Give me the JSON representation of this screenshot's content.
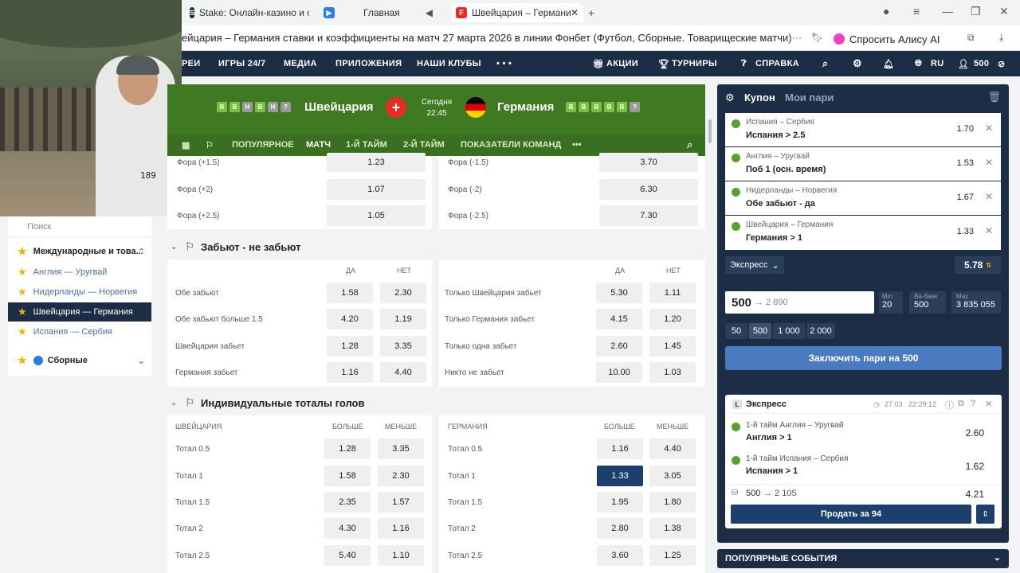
{
  "browser": {
    "tabs": [
      {
        "label": "Stake: Онлайн-казино и с"
      },
      {
        "label": "Главная"
      },
      {
        "label": "Швейцария – Германи"
      }
    ],
    "url": "ейцария – Германия ставки и коэффициенты на матч 27 марта 2026 в линии Фонбет (Футбол, Сборные. Товарищеские матчи)",
    "alice": "Спросить Алису AI"
  },
  "nav": {
    "items": [
      "РЕИ",
      "ИГРЫ 24/7",
      "МЕДИА",
      "ПРИЛОЖЕНИЯ",
      "НАШИ КЛУБЫ",
      "АКЦИИ",
      "ТУРНИРЫ",
      "СПРАВКА",
      "RU",
      "500"
    ]
  },
  "webcam": {
    "shirt_number": "189"
  },
  "sidebar": {
    "search_placeholder": "Поиск",
    "group": "Международные и това...",
    "items": [
      "Англия — Уругвай",
      "Нидерланды — Норвегия",
      "Швейцария — Германия",
      "Испания — Сербия"
    ],
    "category": "Сборные"
  },
  "match": {
    "home": "Швейцария",
    "away": "Германия",
    "day": "Сегодня",
    "time": "22:45",
    "home_form": [
      "В",
      "В",
      "Н",
      "В",
      "Н"
    ],
    "away_form": [
      "В",
      "В",
      "В",
      "В",
      "В"
    ],
    "tabs": [
      "ПОПУЛЯРНОЕ",
      "МАТЧ",
      "1-Й ТАЙМ",
      "2-Й ТАЙМ",
      "ПОКАЗАТЕЛИ КОМАНД"
    ],
    "active_tab": "МАТЧ"
  },
  "handicap": {
    "rows": [
      {
        "l": "Фора (+1.5)",
        "lo": "1.23",
        "r": "Фора (-1.5)",
        "ro": "3.70"
      },
      {
        "l": "Фора (+2)",
        "lo": "1.07",
        "r": "Фора (-2)",
        "ro": "6.30"
      },
      {
        "l": "Фора (+2.5)",
        "lo": "1.05",
        "r": "Фора (-2.5)",
        "ro": "7.30"
      }
    ]
  },
  "btts": {
    "title": "Забьют - не забьют",
    "yes": "ДА",
    "no": "НЕТ",
    "rows": [
      {
        "l": "Обе забьют",
        "ly": "1.58",
        "ln": "2.30",
        "r": "Только Швейцария забьет",
        "ry": "5.30",
        "rn": "1.11"
      },
      {
        "l": "Обе забьют больше 1.5",
        "ly": "4.20",
        "ln": "1.19",
        "r": "Только Германия забьет",
        "ry": "4.15",
        "rn": "1.20"
      },
      {
        "l": "Швейцария забьет",
        "ly": "1.28",
        "ln": "3.35",
        "r": "Только одна забьет",
        "ry": "2.60",
        "rn": "1.45"
      },
      {
        "l": "Германия забьет",
        "ly": "1.16",
        "ln": "4.40",
        "r": "Никто не забьет",
        "ry": "10.00",
        "rn": "1.03"
      }
    ]
  },
  "totals": {
    "title": "Индивидуальные тоталы голов",
    "home": "ШВЕЙЦАРИЯ",
    "away": "ГЕРМАНИЯ",
    "over": "БОЛЬШЕ",
    "under": "МЕНЬШЕ",
    "rows": [
      {
        "l": "Тотал 0.5",
        "lo": "1.28",
        "lu": "3.35",
        "r": "Тотал 0.5",
        "ro": "1.16",
        "ru": "4.40"
      },
      {
        "l": "Тотал 1",
        "lo": "1.58",
        "lu": "2.30",
        "r": "Тотал 1",
        "ro": "1.33",
        "ru": "3.05"
      },
      {
        "l": "Тотал 1.5",
        "lo": "2.35",
        "lu": "1.57",
        "r": "Тотал 1.5",
        "ro": "1.95",
        "ru": "1.80"
      },
      {
        "l": "Тотал 2",
        "lo": "4.30",
        "lu": "1.16",
        "r": "Тотал 2",
        "ro": "2.80",
        "ru": "1.38"
      },
      {
        "l": "Тотал 2.5",
        "lo": "5.40",
        "lu": "1.10",
        "r": "Тотал 2.5",
        "ro": "3.60",
        "ru": "1.25"
      }
    ]
  },
  "coupon": {
    "title": "Купон",
    "my_bets": "Мои пари",
    "items": [
      {
        "event": "Испания – Сербия",
        "bet": "Испания > 2.5",
        "odd": "1.70"
      },
      {
        "event": "Англия – Уругвай",
        "bet": "Поб 1 (осн. время)",
        "odd": "1.53"
      },
      {
        "event": "Нидерланды – Норвегия",
        "bet": "Обе забьют - да",
        "odd": "1.67"
      },
      {
        "event": "Швейцария – Германия",
        "bet": "Германия > 1",
        "odd": "1.33"
      }
    ],
    "type": "Экспресс",
    "total_odd": "5.78",
    "stake": "500",
    "payout": "→ 2 890",
    "min_label": "Min",
    "min": "20",
    "vabank_label": "Ва-банк",
    "vabank": "500",
    "max_label": "Max",
    "max": "3 835 055",
    "chips": [
      "50",
      "500",
      "1 000",
      "2 000"
    ],
    "place_btn": "Заключить пари на 500"
  },
  "placed": {
    "type": "Экспресс",
    "date": "27.03",
    "time": "22:29:12",
    "items": [
      {
        "event": "1-й тайм Англия – Уругвай",
        "bet": "Англия > 1",
        "odd": "2.60"
      },
      {
        "event": "1-й тайм Испания – Сербия",
        "bet": "Испания > 1",
        "odd": "1.62"
      }
    ],
    "stake": "500",
    "payout": "→ 2 105",
    "odd": "4.21",
    "sell_btn": "Продать за 94"
  },
  "popular": "ПОПУЛЯРНЫЕ СОБЫТИЯ"
}
